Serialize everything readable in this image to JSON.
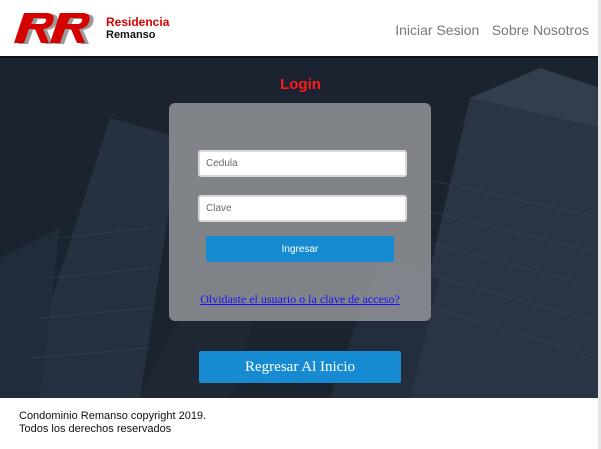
{
  "header": {
    "brand_line1": "Residencia",
    "brand_line2": "Remanso",
    "logo_letters": "RR",
    "nav": [
      {
        "label": "Iniciar Sesion"
      },
      {
        "label": "Sobre Nosotros"
      }
    ]
  },
  "login": {
    "title": "Login",
    "cedula_placeholder": "Cedula",
    "clave_placeholder": "Clave",
    "submit_label": "Ingresar",
    "forgot_link": "Olvidaste el usuario o la clave de acceso?",
    "back_label": "Regresar Al Inicio"
  },
  "footer": {
    "line1": "Condominio Remanso copyright 2019.",
    "line2": "Todos los derechos reservados"
  },
  "colors": {
    "accent": "#168bd1",
    "title_red": "#ff1a1a",
    "link_blue": "#1a10ff",
    "hero_bg": "#1e2633"
  }
}
